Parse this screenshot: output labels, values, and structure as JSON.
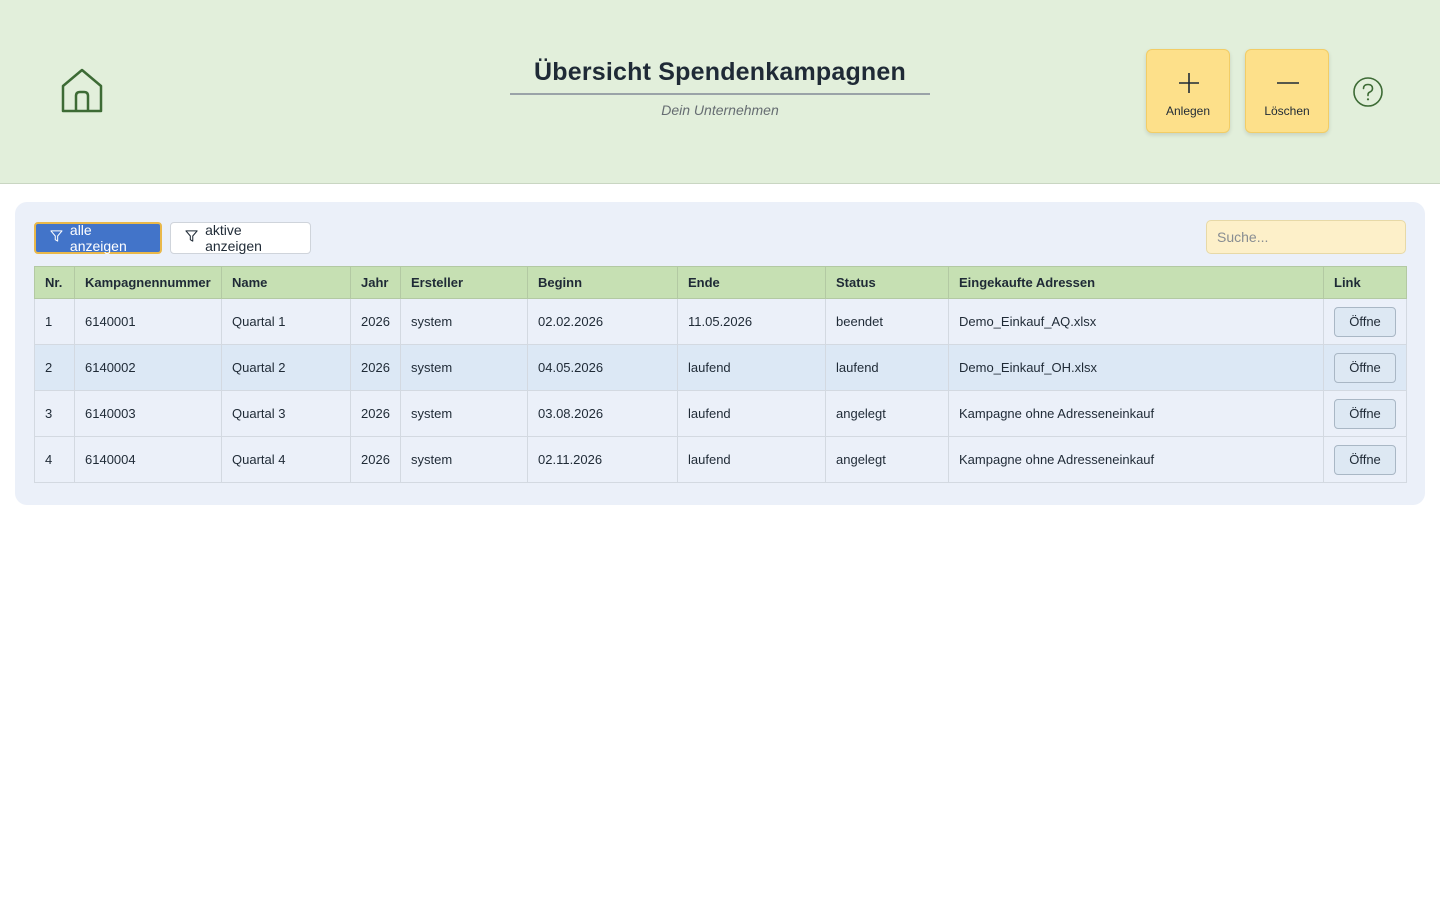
{
  "header": {
    "title": "Übersicht Spendenkampagnen",
    "subtitle": "Dein Unternehmen",
    "add_label": "Anlegen",
    "delete_label": "Löschen"
  },
  "toolbar": {
    "filter_all_label": "alle anzeigen",
    "filter_active_label": "aktive anzeigen",
    "search_placeholder": "Suche..."
  },
  "table": {
    "columns": [
      "Nr.",
      "Kampagnennummer",
      "Name",
      "Jahr",
      "Ersteller",
      "Beginn",
      "Ende",
      "Status",
      "Eingekaufte Adressen",
      "Link"
    ],
    "rows": [
      [
        "1",
        "6140001",
        "Quartal 1",
        "2026",
        "system",
        "02.02.2026",
        "11.05.2026",
        "beendet",
        "Demo_Einkauf_AQ.xlsx",
        "Öffne"
      ],
      [
        "2",
        "6140002",
        "Quartal 2",
        "2026",
        "system",
        "04.05.2026",
        "laufend",
        "laufend",
        "Demo_Einkauf_OH.xlsx",
        "Öffne"
      ],
      [
        "3",
        "6140003",
        "Quartal 3",
        "2026",
        "system",
        "03.08.2026",
        "laufend",
        "angelegt",
        "Kampagne ohne Adresseneinkauf",
        "Öffne"
      ],
      [
        "4",
        "6140004",
        "Quartal 4",
        "2026",
        "system",
        "02.11.2026",
        "laufend",
        "angelegt",
        "Kampagne ohne Adresseneinkauf",
        "Öffne"
      ]
    ]
  },
  "icons": {
    "home": "home-icon",
    "add": "plus-icon",
    "delete": "minus-icon",
    "help": "help-icon",
    "filter": "filter-icon"
  },
  "colors": {
    "header_bg": "#e2efdb",
    "accent_button": "#fde08a",
    "primary": "#4274c9",
    "table_header": "#c6e0b3",
    "icon_green": "#3d6b35"
  }
}
